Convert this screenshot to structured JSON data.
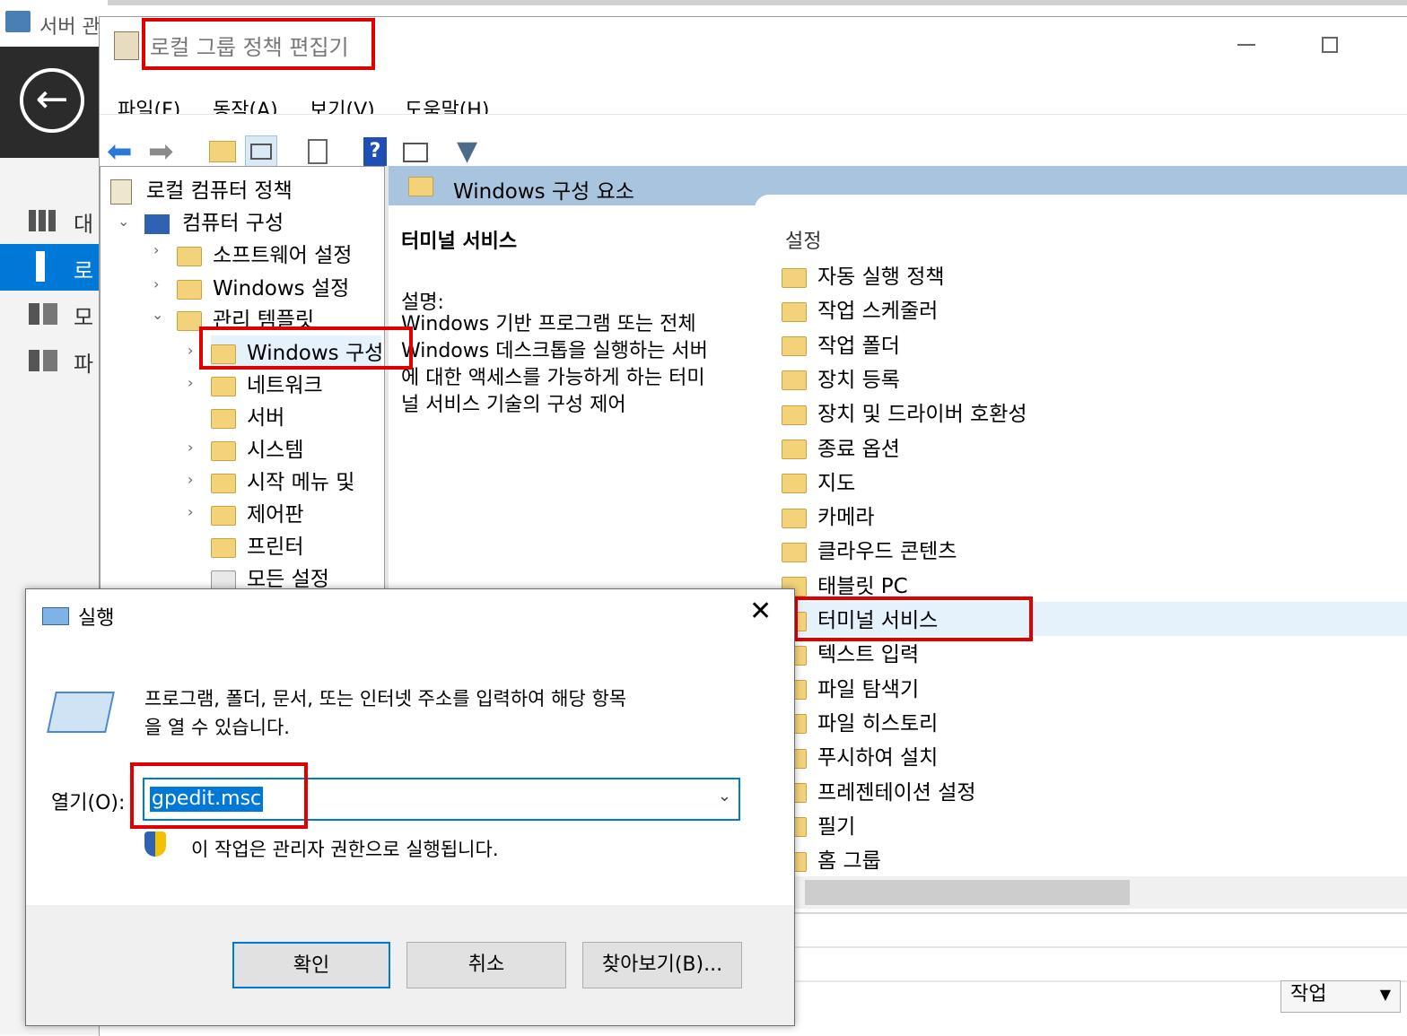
{
  "server_manager": {
    "title": "서버 관리자",
    "sidebar": [
      {
        "label": "대",
        "icon": "dashboard-icon"
      },
      {
        "label": "로",
        "icon": "local-server-icon"
      },
      {
        "label": "모",
        "icon": "all-servers-icon"
      },
      {
        "label": "파",
        "icon": "file-services-icon"
      }
    ]
  },
  "gpedit": {
    "title": "로컬 그룹 정책 편집기",
    "menu": [
      "파일(F)",
      "동작(A)",
      "보기(V)",
      "도움말(H)"
    ],
    "tree": {
      "root": "로컬 컴퓨터 정책",
      "computer_config": "컴퓨터 구성",
      "software_settings": "소프트웨어 설정",
      "windows_settings": "Windows 설정",
      "admin_templates": "관리 템플릿",
      "windows_components": "Windows 구성",
      "network": "네트워크",
      "server": "서버",
      "system": "시스템",
      "start_menu": "시작 메뉴 및",
      "control_panel": "제어판",
      "printers": "프린터",
      "all_settings": "모든 설정"
    },
    "content_header": "Windows 구성 요소",
    "detail": {
      "title": "터미널 서비스",
      "desc_label": "설명:",
      "description_lines": [
        "Windows 기반 프로그램 또는 전체",
        "Windows 데스크톱을 실행하는 서버",
        "에 대한 액세스를 가능하게 하는 터미",
        "널 서비스 기술의 구성 제어"
      ]
    },
    "settings_header": "설정",
    "settings": [
      "자동 실행 정책",
      "작업 스케줄러",
      "작업 폴더",
      "장치 등록",
      "장치 및 드라이버 호환성",
      "종료 옵션",
      "지도",
      "카메라",
      "클라우드 콘텐츠",
      "태블릿 PC",
      "터미널 서비스",
      "텍스트 입력",
      "파일 탐색기",
      "파일 히스토리",
      "푸시하여 설치",
      "프레젠테이션 설정",
      "필기",
      "홈 그룹"
    ],
    "selected_setting": "터미널 서비스",
    "tasks_dropdown": "작업"
  },
  "run_dialog": {
    "title": "실행",
    "description_line1": "프로그램, 폴더, 문서, 또는 인터넷 주소를 입력하여 해당 항목",
    "description_line2": "을 열 수 있습니다.",
    "open_label": "열기(O):",
    "open_value": "gpedit.msc",
    "admin_note": "이 작업은 관리자 권한으로 실행됩니다.",
    "ok": "확인",
    "cancel": "취소",
    "browse": "찾아보기(B)..."
  },
  "colors": {
    "highlight_red": "#e00000",
    "selection_blue": "#0078d7",
    "header_blue": "#a9c4de"
  }
}
